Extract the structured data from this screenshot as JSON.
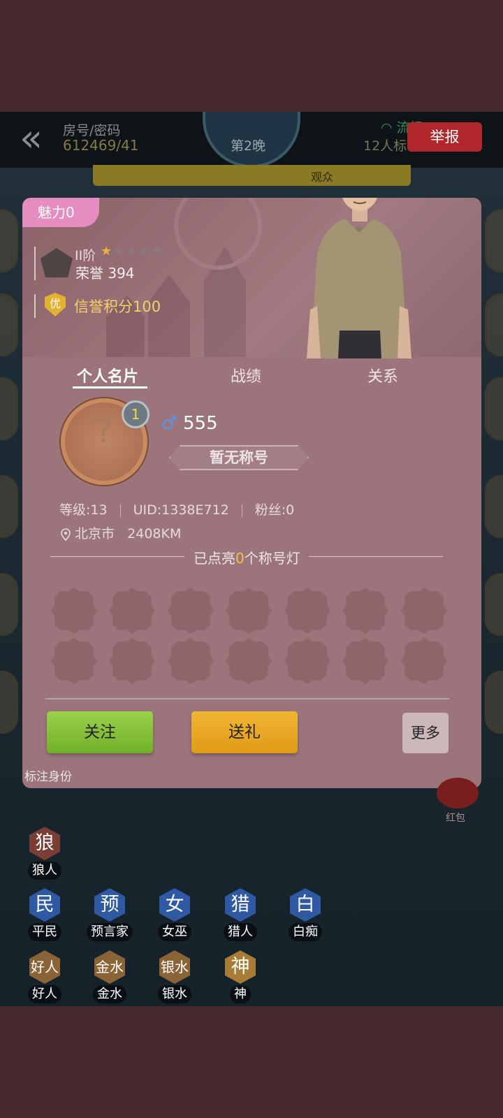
{
  "header": {
    "room_label": "房号/密码",
    "room_code": "612469/41",
    "night": "第2晚",
    "signal": "流畅",
    "players": "12人标",
    "report_button": "举报",
    "banner_text": "观众"
  },
  "profile_card": {
    "charm_label": "魅力0",
    "rank": {
      "tier": "II阶",
      "stars_filled": 1,
      "stars_total": 5,
      "honor": "荣誉 394"
    },
    "credit": {
      "badge": "优",
      "text": "信誉积分100"
    },
    "tabs": [
      {
        "label": "个人名片",
        "active": true
      },
      {
        "label": "战绩",
        "active": false
      },
      {
        "label": "关系",
        "active": false
      }
    ],
    "user": {
      "level_badge": "1",
      "gender_icon": "♂",
      "name": "555",
      "title": "暂无称号",
      "level": "等级:13",
      "uid": "UID:1338E712",
      "fans": "粉丝:0",
      "city": "北京市",
      "distance": "2408KM"
    },
    "lights": {
      "prefix": "已点亮",
      "count": "0",
      "suffix": "个称号灯"
    },
    "buttons": {
      "follow": "关注",
      "gift": "送礼",
      "more": "更多"
    }
  },
  "identity_panel": {
    "title": "标注身份",
    "roles_row1": [
      {
        "glyph": "狼",
        "label": "狼人"
      }
    ],
    "roles_row2": [
      {
        "glyph": "民",
        "label": "平民"
      },
      {
        "glyph": "预",
        "label": "预言家"
      },
      {
        "glyph": "女",
        "label": "女巫"
      },
      {
        "glyph": "猎",
        "label": "猎人"
      },
      {
        "glyph": "白",
        "label": "白痴"
      }
    ],
    "roles_row3": [
      {
        "glyph": "好人",
        "label": "好人"
      },
      {
        "glyph": "金水",
        "label": "金水"
      },
      {
        "glyph": "银水",
        "label": "银水"
      },
      {
        "glyph": "神",
        "label": "神"
      }
    ],
    "redpack_label": "红包"
  },
  "colors": {
    "card_bg": "#9b757b",
    "charm_tag": "#e58cc0",
    "follow_green": "#85c13a",
    "gift_orange": "#e8a823",
    "report_red": "#b0262a",
    "credit_gold": "#f4d269"
  }
}
